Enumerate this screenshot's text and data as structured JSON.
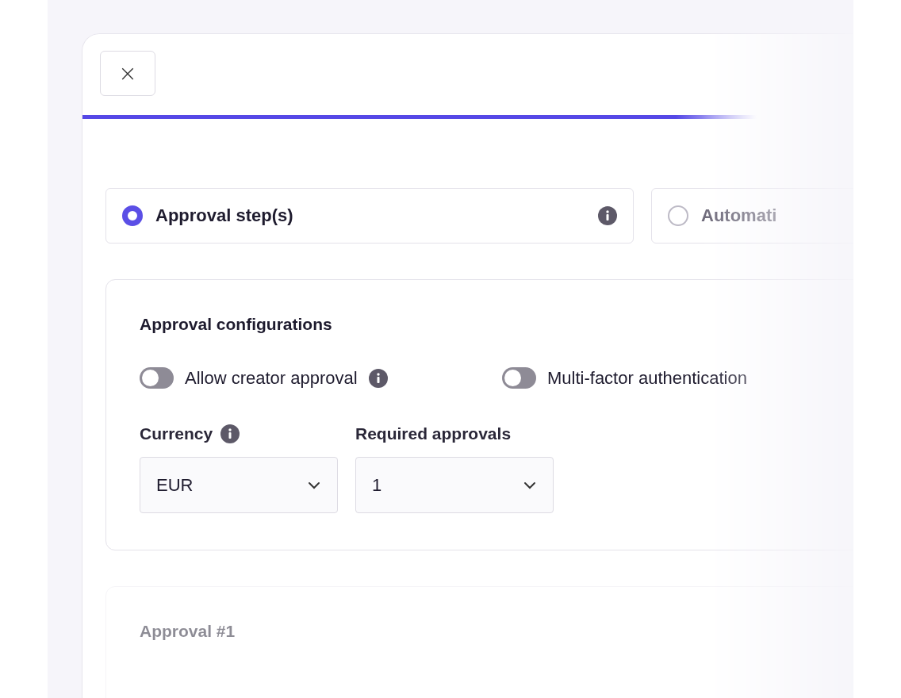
{
  "header": {
    "close": "×",
    "progress": {
      "level": 0.85
    }
  },
  "options": [
    {
      "label": "Approval step(s)",
      "selected": true,
      "info": true
    },
    {
      "label": "Automati",
      "selected": false,
      "info": false
    }
  ],
  "config": {
    "title": "Approval configurations",
    "toggles": [
      {
        "label": "Allow creator approval",
        "on": false,
        "info": true
      },
      {
        "label": "Multi-factor authentication",
        "on": false,
        "info": false
      }
    ],
    "selects": [
      {
        "label": "Currency",
        "value": "EUR",
        "info": true
      },
      {
        "label": "Required approvals",
        "value": "1",
        "info": false
      }
    ]
  },
  "approval": {
    "title": "Approval #1"
  }
}
